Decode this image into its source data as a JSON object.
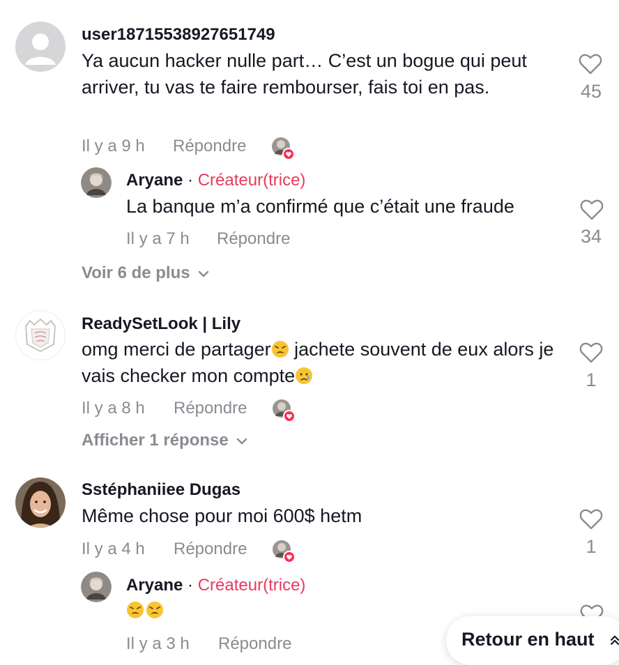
{
  "comments": [
    {
      "username": "user18715538927651749",
      "text": "Ya aucun hacker nulle part… C’est un bogue qui peut arriver, tu vas te faire rembourser, fais toi en pas.",
      "time": "Il y a 9 h",
      "reply_label": "Répondre",
      "likes": "45",
      "replies": [
        {
          "username": "Aryane",
          "separator": "·",
          "badge": "Créateur(trice)",
          "text": "La banque m’a confirmé que c’était une fraude",
          "time": "Il y a 7 h",
          "reply_label": "Répondre",
          "likes": "34"
        }
      ],
      "more_label": "Voir 6 de plus"
    },
    {
      "username": "ReadySetLook | Lily",
      "text_parts": [
        "omg merci de partager",
        " jachete souvent de eux alors je vais checker mon compte"
      ],
      "emojis": [
        "weary-face-emoji",
        "crying-face-emoji"
      ],
      "time": "Il y a 8 h",
      "reply_label": "Répondre",
      "likes": "1",
      "more_label": "Afficher 1 réponse"
    },
    {
      "username": "Sstéphaniiee Dugas",
      "text": "Même chose pour moi 600$ hetm",
      "time": "Il y a 4 h",
      "reply_label": "Répondre",
      "likes": "1",
      "replies": [
        {
          "username": "Aryane",
          "separator": "·",
          "badge": "Créateur(trice)",
          "emojis": [
            "weary-face-emoji",
            "weary-face-emoji"
          ],
          "time": "Il y a 3 h",
          "reply_label": "Répondre"
        }
      ]
    }
  ],
  "back_to_top": "Retour en haut",
  "colors": {
    "creator_badge": "#e83a5e",
    "muted_text": "#8a8b91",
    "primary_text": "#161823",
    "heart_badge": "#fe2c55"
  }
}
